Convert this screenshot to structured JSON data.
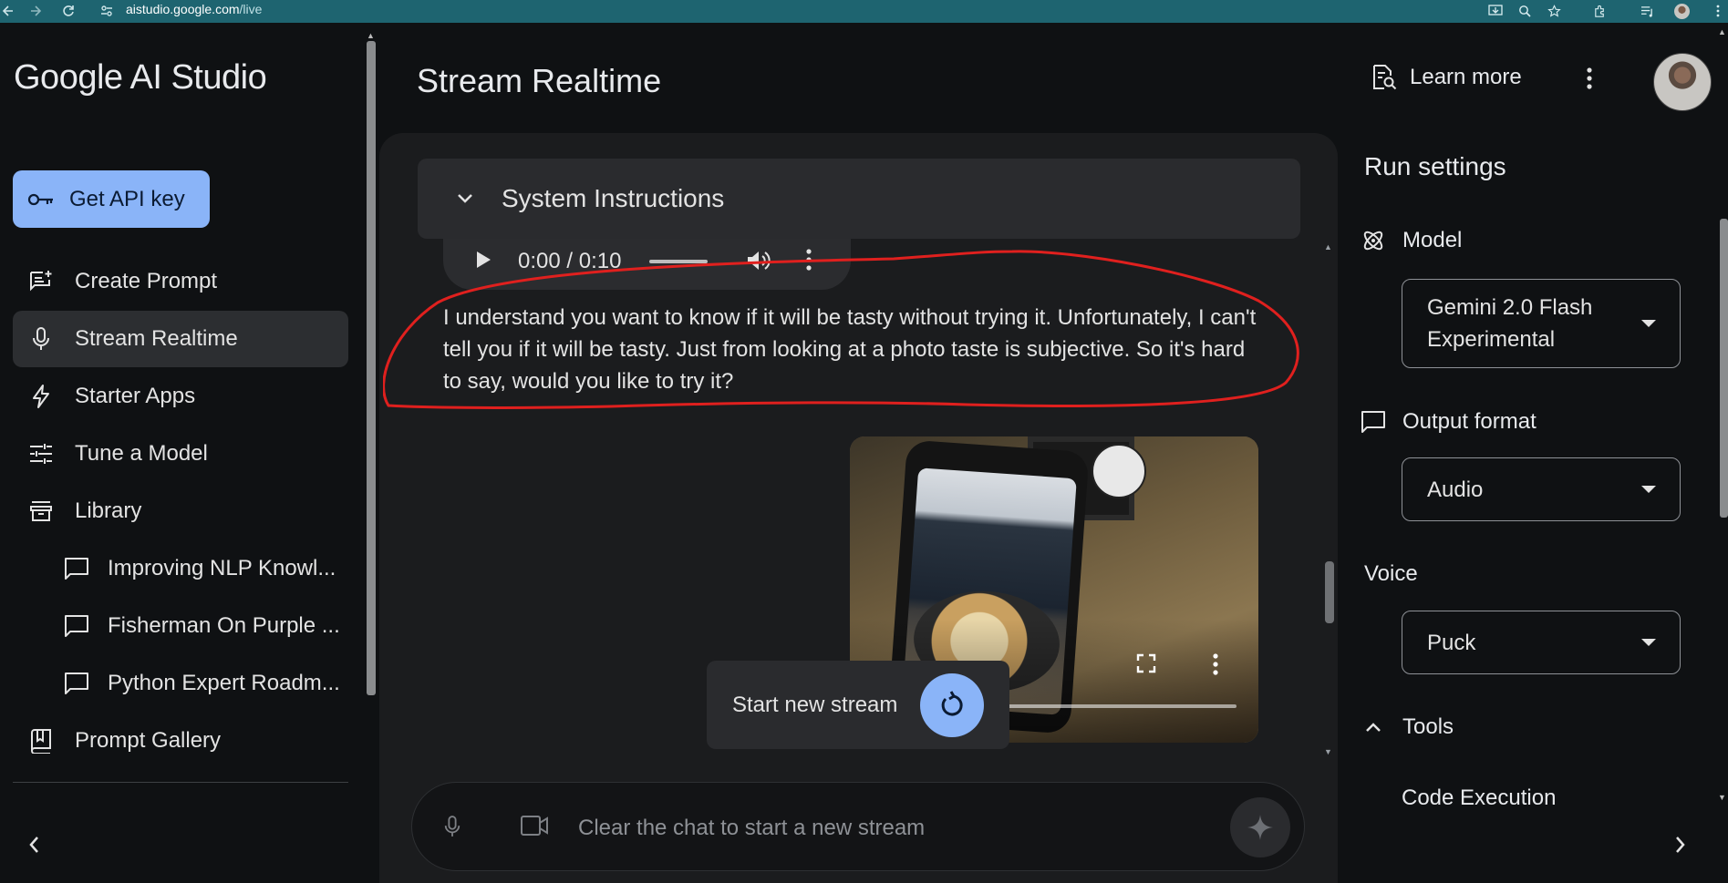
{
  "browser": {
    "url_host": "aistudio.google.com",
    "url_path": "/live",
    "icons": [
      "back-icon",
      "forward-icon",
      "reload-icon",
      "site-info-icon",
      "install-app-icon",
      "zoom-icon",
      "bookmark-star-icon",
      "extensions-icon",
      "media-icon",
      "profile-icon",
      "menu-icon"
    ]
  },
  "sidebar": {
    "brand": "Google AI Studio",
    "api_button": "Get API key",
    "items": [
      {
        "label": "Create Prompt",
        "icon": "create-prompt-icon"
      },
      {
        "label": "Stream Realtime",
        "icon": "mic-icon",
        "active": true
      },
      {
        "label": "Starter Apps",
        "icon": "bolt-icon"
      },
      {
        "label": "Tune a Model",
        "icon": "tune-icon"
      },
      {
        "label": "Library",
        "icon": "library-icon"
      }
    ],
    "library_items": [
      {
        "label": "Improving NLP Knowl..."
      },
      {
        "label": "Fisherman On Purple ..."
      },
      {
        "label": "Python Expert Roadm..."
      }
    ],
    "gallery": "Prompt Gallery"
  },
  "header": {
    "title": "Stream Realtime",
    "learn_more": "Learn more"
  },
  "chat": {
    "system_instructions": "System Instructions",
    "audio": {
      "time": "0:00 / 0:10"
    },
    "response_text": "I understand you want to know if it will be tasty without trying it. Unfortunately, I can't tell you if it will be tasty. Just from looking at a photo taste is subjective. So it's hard to say, would you like to try it?",
    "toast": "Start new stream",
    "input_placeholder": "Clear the chat to start a new stream",
    "annotation_color": "#e0201e"
  },
  "run_settings": {
    "title": "Run settings",
    "model_label": "Model",
    "model_value": "Gemini 2.0 Flash Experimental",
    "output_label": "Output format",
    "output_value": "Audio",
    "voice_label": "Voice",
    "voice_value": "Puck",
    "tools_label": "Tools",
    "code_execution": "Code Execution"
  },
  "colors": {
    "accent": "#8ab4f8",
    "background": "#0f1113",
    "chrome": "#1e6470"
  }
}
